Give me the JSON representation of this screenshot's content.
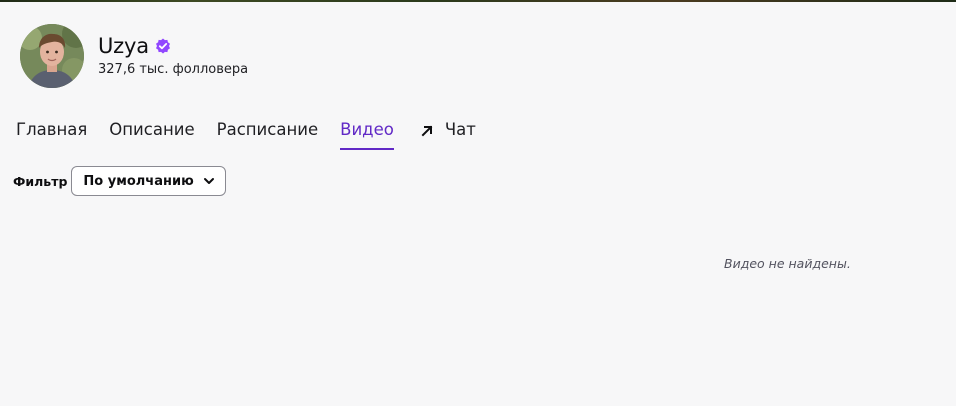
{
  "channel": {
    "name": "Uzya",
    "followers": "327,6 тыс. фолловера",
    "verified": true,
    "verified_color": "#9147ff"
  },
  "tabs": [
    {
      "label": "Главная",
      "active": false
    },
    {
      "label": "Описание",
      "active": false
    },
    {
      "label": "Расписание",
      "active": false
    },
    {
      "label": "Видео",
      "active": true
    },
    {
      "label": "Чат",
      "active": false,
      "icon": "external-arrow-icon"
    }
  ],
  "filter": {
    "label": "Фильтр",
    "value": "По умолчанию"
  },
  "empty_state": "Видео не найдены.",
  "colors": {
    "accent": "#6129c6",
    "background": "#f7f7f8"
  }
}
